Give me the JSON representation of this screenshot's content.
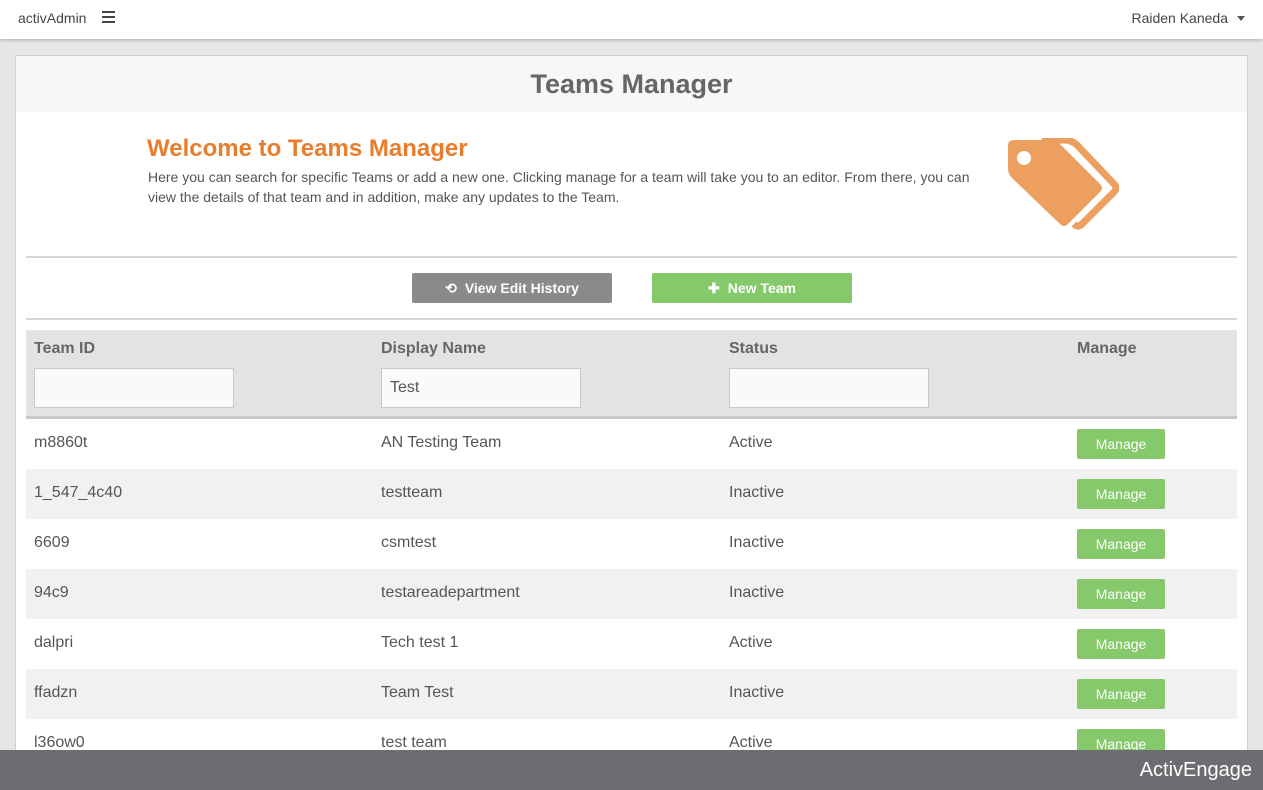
{
  "topbar": {
    "brand": "activAdmin",
    "menu_icon": "hamburger-icon",
    "user_name": "Raiden Kaneda"
  },
  "page": {
    "title": "Teams Manager",
    "welcome_title": "Welcome to Teams Manager",
    "welcome_desc": "Here you can search for specific Teams or add a new one. Clicking manage for a team will take you to an editor. From there, you can view the details of that team and in addition, make any updates to the Team.",
    "illustration_icon": "tags-icon",
    "accent_color": "#e87d2d"
  },
  "actions": {
    "history_label": "View Edit History",
    "history_icon": "history-icon",
    "new_label": "New Team",
    "new_icon": "plus-icon"
  },
  "table": {
    "columns": [
      "Team ID",
      "Display Name",
      "Status",
      "Manage"
    ],
    "filters": {
      "team_id": "",
      "display_name": "Test",
      "status": ""
    },
    "manage_label": "Manage",
    "rows": [
      {
        "id": "m8860t",
        "name": "AN Testing Team",
        "status": "Active"
      },
      {
        "id": "1_547_4c40",
        "name": "testteam",
        "status": "Inactive"
      },
      {
        "id": "6609",
        "name": "csmtest",
        "status": "Inactive"
      },
      {
        "id": "94c9",
        "name": "testareadepartment",
        "status": "Inactive"
      },
      {
        "id": "dalpri",
        "name": "Tech test 1",
        "status": "Active"
      },
      {
        "id": "ffadzn",
        "name": "Team Test",
        "status": "Inactive"
      },
      {
        "id": "l36ow0",
        "name": "test team",
        "status": "Active"
      }
    ]
  },
  "footer": {
    "brand": "ActivEngage"
  },
  "colors": {
    "button_green": "#85c96a",
    "button_gray": "#8a8a8a",
    "footer_bg": "#6c6d70"
  }
}
